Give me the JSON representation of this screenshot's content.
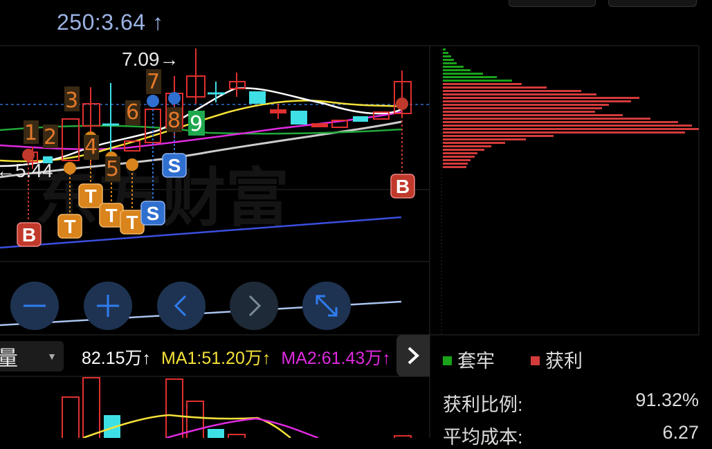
{
  "ma250_label": "250:3.64 ↑",
  "price_high_label": "7.09→",
  "price_low_label": "←5.44",
  "watermark": "东方财富",
  "nine_turn_numbers": [
    "1",
    "2",
    "3",
    "4",
    "5",
    "6",
    "7",
    "8",
    "9"
  ],
  "signal_badges": {
    "buy": "B",
    "sell": "S",
    "t": "T"
  },
  "controls": [
    "zoom-out",
    "zoom-in",
    "scroll-left",
    "scroll-right",
    "fullscreen"
  ],
  "volume": {
    "indicator": "量",
    "value": "82.15万↑",
    "ma1": "MA1:51.20万↑",
    "ma2": "MA2:61.43万↑",
    "colors": {
      "value": "#ffffff",
      "ma1": "#f5e23a",
      "ma2": "#e02ae0"
    }
  },
  "chip": {
    "legend": [
      {
        "label": "套牢",
        "color": "#1aa31a"
      },
      {
        "label": "获利",
        "color": "#d43b3b"
      }
    ],
    "stats": [
      {
        "label": "获利比例:",
        "value": "91.32%"
      },
      {
        "label": "平均成本:",
        "value": "6.27"
      }
    ]
  },
  "colors": {
    "up": "#e0302f",
    "down": "#3ee0e6",
    "ma5": "#ffffff",
    "ma10": "#f5e23a",
    "ma20": "#e02ae0",
    "ma30": "#22a83a",
    "ma60": "#cccccc",
    "ma120": "#3b4fe0"
  }
}
